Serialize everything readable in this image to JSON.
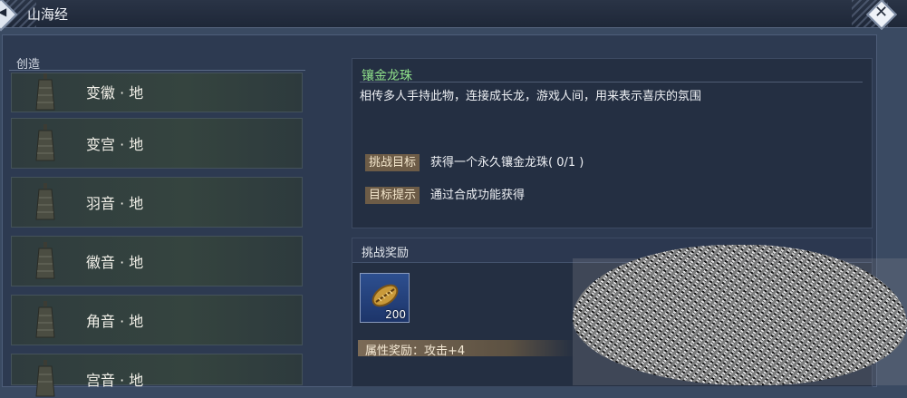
{
  "window": {
    "title": "山海经",
    "close_icon": "close-icon",
    "nav_icon": "chevron-left-icon"
  },
  "list": {
    "header": "创造",
    "items": [
      {
        "label": "变徽 · 地",
        "icon": "bell-icon"
      },
      {
        "label": "变宫 · 地",
        "icon": "bell-icon"
      },
      {
        "label": "羽音 · 地",
        "icon": "bell-icon"
      },
      {
        "label": "徽音 · 地",
        "icon": "bell-icon"
      },
      {
        "label": "角音 · 地",
        "icon": "bell-icon"
      },
      {
        "label": "宫音 · 地",
        "icon": "bell-icon"
      }
    ]
  },
  "task": {
    "title": "镶金龙珠",
    "description": "相传多人手持此物，连接成长龙，游戏人间，用来表示喜庆的氛围",
    "goal_tag": "挑战目标",
    "goal_text": "获得一个永久镶金龙珠( 0/1 )",
    "hint_tag": "目标提示",
    "hint_text": "通过合成功能获得"
  },
  "reward": {
    "header": "挑战奖励",
    "item_icon": "gold-coin-icon",
    "item_count": "200",
    "attr_bonus": "属性奖励：攻击+4"
  },
  "colors": {
    "background": "#3a4a62",
    "task_title": "#8fe08a",
    "tag_bg": "#6d5c47",
    "slot_bg": "#2d4f8f"
  }
}
